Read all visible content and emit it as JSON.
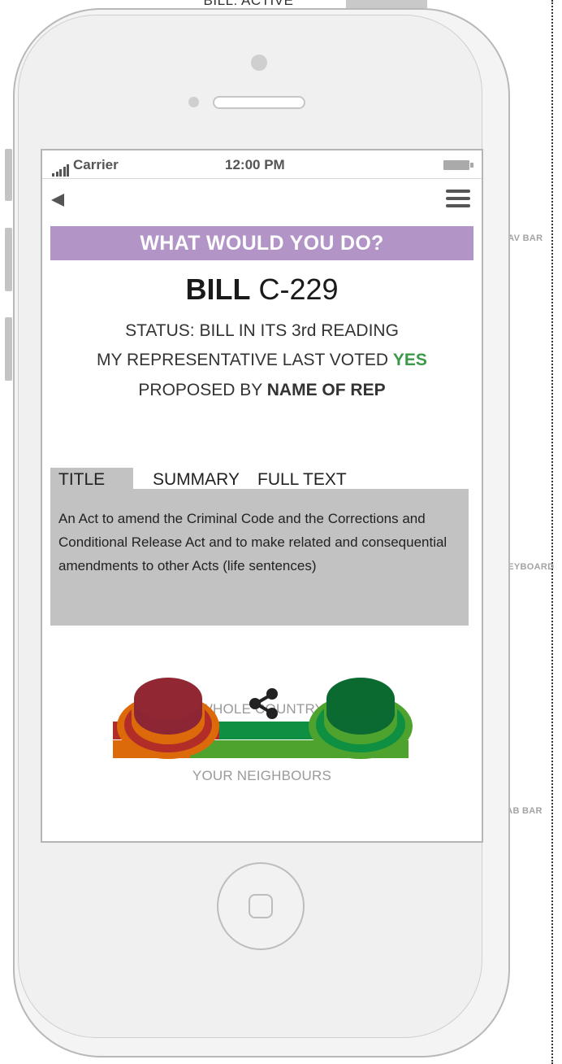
{
  "wireframe": {
    "caption": "BILL: ACTIVE",
    "annotations": {
      "nav_bar": "NAV BAR",
      "keyboard": "KEYBOARD",
      "tab_bar": "TAB BAR"
    }
  },
  "status_bar": {
    "carrier": "Carrier",
    "time": "12:00 PM"
  },
  "header": {
    "title": "WHAT WOULD YOU DO?"
  },
  "bill": {
    "label": "BILL",
    "number": "C-229",
    "status": "STATUS: BILL IN ITS 3rd READING",
    "rep_vote_prefix": "MY REPRESENTATIVE LAST VOTED ",
    "rep_vote_value": "YES",
    "proposed_prefix": "PROPOSED BY ",
    "proposed_by": "NAME OF REP"
  },
  "tabs": [
    {
      "label": "TITLE",
      "active": true
    },
    {
      "label": "SUMMARY",
      "active": false
    },
    {
      "label": "FULL TEXT",
      "active": false
    }
  ],
  "tab_content": "An Act to amend the Criminal Code and the Corrections and Conditional Release Act and to make related and consequential amendments to other Acts (life sentences)",
  "results": {
    "whole_country_label": "WHOLE COUNTRY",
    "neighbours_label": "YOUR NEIGHBOURS",
    "whole_country": {
      "no_fraction": 0.36,
      "yes_fraction": 0.64
    },
    "neighbours": {
      "no_fraction": 0.26,
      "yes_fraction": 0.74
    }
  },
  "colors": {
    "header": "#b294c7",
    "yes_text": "#3a9a4a",
    "country_no": "#b22d27",
    "country_yes": "#0f8f42",
    "neighbour_no": "#dd6a0a",
    "neighbour_yes": "#4da32e"
  },
  "icons": {
    "back": "back-arrow-icon",
    "menu": "hamburger-menu-icon",
    "share": "share-icon",
    "vote_no": "vote-no-button",
    "vote_yes": "vote-yes-button"
  }
}
